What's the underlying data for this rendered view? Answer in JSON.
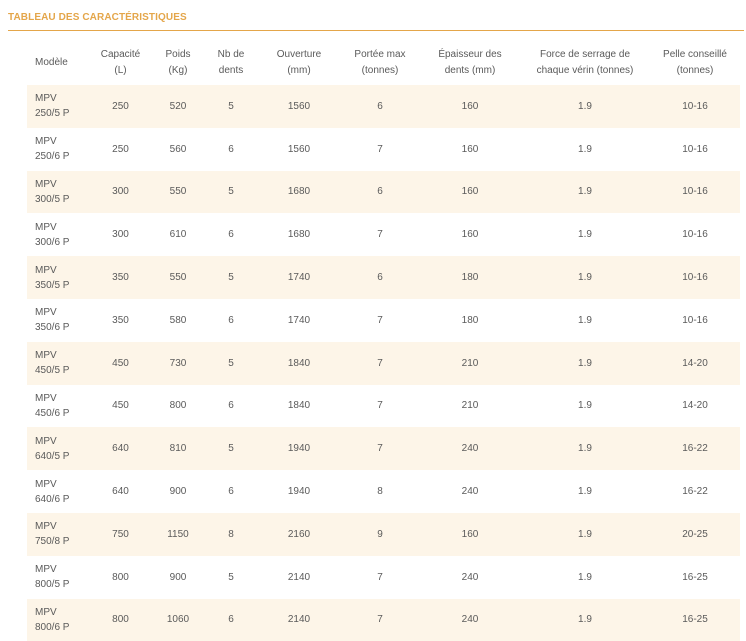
{
  "section_title": "TABLEAU DES CARACTÉRISTIQUES",
  "headers": [
    [
      "Modèle"
    ],
    [
      "Capacité",
      "(L)"
    ],
    [
      "Poids",
      "(Kg)"
    ],
    [
      "Nb de",
      "dents"
    ],
    [
      "Ouverture",
      "(mm)"
    ],
    [
      "Portée max",
      "(tonnes)"
    ],
    [
      "Épaisseur des",
      "dents (mm)"
    ],
    [
      "Force de serrage de",
      "chaque vérin (tonnes)"
    ],
    [
      "Pelle conseillé",
      "(tonnes)"
    ]
  ],
  "rows": [
    {
      "model": [
        "MPV",
        "250/5 P"
      ],
      "values": [
        "250",
        "520",
        "5",
        "1560",
        "6",
        "160",
        "1.9",
        "10-16"
      ]
    },
    {
      "model": [
        "MPV",
        "250/6 P"
      ],
      "values": [
        "250",
        "560",
        "6",
        "1560",
        "7",
        "160",
        "1.9",
        "10-16"
      ]
    },
    {
      "model": [
        "MPV",
        "300/5 P"
      ],
      "values": [
        "300",
        "550",
        "5",
        "1680",
        "6",
        "160",
        "1.9",
        "10-16"
      ]
    },
    {
      "model": [
        "MPV",
        "300/6 P"
      ],
      "values": [
        "300",
        "610",
        "6",
        "1680",
        "7",
        "160",
        "1.9",
        "10-16"
      ]
    },
    {
      "model": [
        "MPV",
        "350/5 P"
      ],
      "values": [
        "350",
        "550",
        "5",
        "1740",
        "6",
        "180",
        "1.9",
        "10-16"
      ]
    },
    {
      "model": [
        "MPV",
        "350/6 P"
      ],
      "values": [
        "350",
        "580",
        "6",
        "1740",
        "7",
        "180",
        "1.9",
        "10-16"
      ]
    },
    {
      "model": [
        "MPV",
        "450/5 P"
      ],
      "values": [
        "450",
        "730",
        "5",
        "1840",
        "7",
        "210",
        "1.9",
        "14-20"
      ]
    },
    {
      "model": [
        "MPV",
        "450/6 P"
      ],
      "values": [
        "450",
        "800",
        "6",
        "1840",
        "7",
        "210",
        "1.9",
        "14-20"
      ]
    },
    {
      "model": [
        "MPV",
        "640/5 P"
      ],
      "values": [
        "640",
        "810",
        "5",
        "1940",
        "7",
        "240",
        "1.9",
        "16-22"
      ]
    },
    {
      "model": [
        "MPV",
        "640/6 P"
      ],
      "values": [
        "640",
        "900",
        "6",
        "1940",
        "8",
        "240",
        "1.9",
        "16-22"
      ]
    },
    {
      "model": [
        "MPV",
        "750/8 P"
      ],
      "values": [
        "750",
        "1150",
        "8",
        "2160",
        "9",
        "160",
        "1.9",
        "20-25"
      ]
    },
    {
      "model": [
        "MPV",
        "800/5 P"
      ],
      "values": [
        "800",
        "900",
        "5",
        "2140",
        "7",
        "240",
        "1.9",
        "16-25"
      ]
    },
    {
      "model": [
        "MPV",
        "800/6 P"
      ],
      "values": [
        "800",
        "1060",
        "6",
        "2140",
        "7",
        "240",
        "1.9",
        "16-25"
      ]
    }
  ],
  "colors": {
    "accent": "#e4a64a",
    "row_stripe": "#fdf5e8",
    "text": "#5a5a5a"
  }
}
